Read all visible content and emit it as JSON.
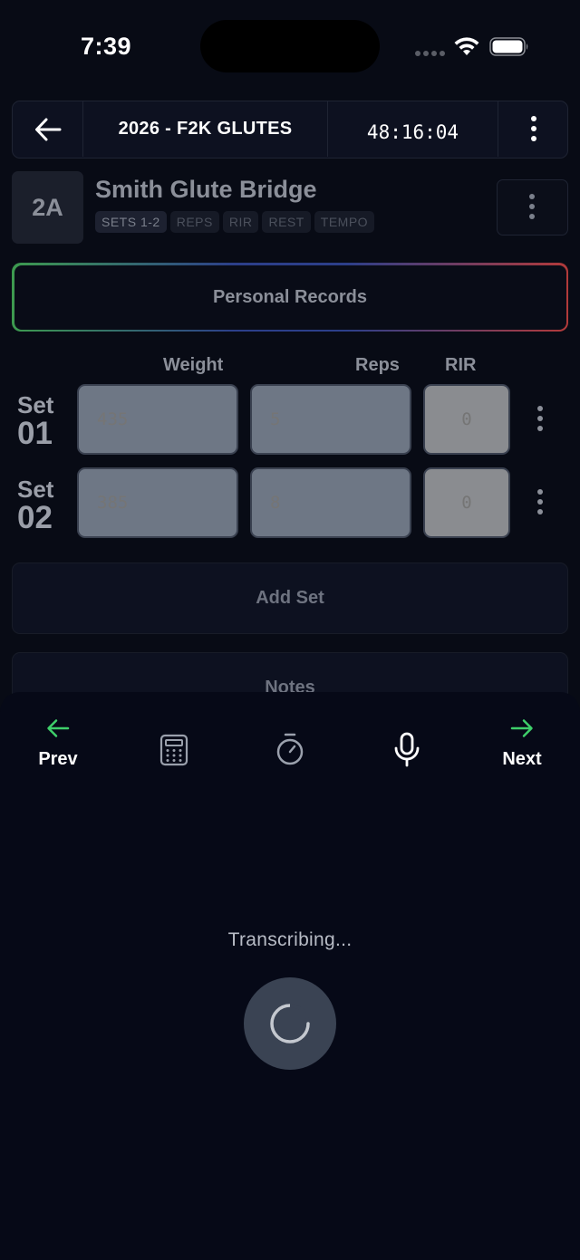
{
  "status_bar": {
    "time": "7:39"
  },
  "header": {
    "workout_title": "2026 - F2K GLUTES",
    "timer": "48:16:04"
  },
  "exercise": {
    "badge": "2A",
    "name": "Smith Glute Bridge",
    "tags": [
      "SETS 1-2",
      "REPS",
      "RIR",
      "REST",
      "TEMPO"
    ]
  },
  "personal_records_label": "Personal Records",
  "columns": {
    "weight": "Weight",
    "reps": "Reps",
    "rir": "RIR"
  },
  "sets": [
    {
      "label": "Set",
      "number": "01",
      "weight_placeholder": "435",
      "reps_placeholder": "5",
      "rir_placeholder": "0"
    },
    {
      "label": "Set",
      "number": "02",
      "weight_placeholder": "385",
      "reps_placeholder": "8",
      "rir_placeholder": "0"
    }
  ],
  "add_set_label": "Add Set",
  "notes_label": "Notes",
  "bottom_sheet": {
    "prev_label": "Prev",
    "next_label": "Next",
    "status_text": "Transcribing..."
  },
  "colors": {
    "background": "#080b15",
    "accent_green": "#3ecf6a",
    "input_fill": "#6e7785"
  },
  "icons": [
    "back-arrow-icon",
    "more-vertical-icon",
    "arrow-left-icon",
    "calculator-icon",
    "stopwatch-icon",
    "microphone-icon",
    "arrow-right-icon",
    "loading-spinner-icon",
    "wifi-icon",
    "battery-icon"
  ]
}
